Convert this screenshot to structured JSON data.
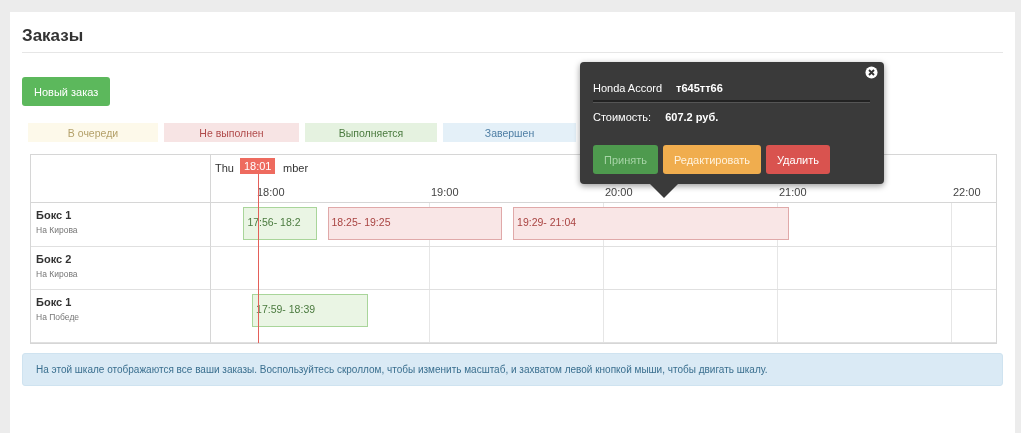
{
  "title": "Заказы",
  "new_order_button": "Новый заказ",
  "legend": [
    {
      "label": "В очереди",
      "kind": "queued"
    },
    {
      "label": "Не выполнен",
      "kind": "failed"
    },
    {
      "label": "Выполняется",
      "kind": "running"
    },
    {
      "label": "Завершен",
      "kind": "done"
    }
  ],
  "timeline": {
    "date_start": "Thu",
    "date_end": "mber",
    "now": "18:01",
    "hours": [
      "18:00",
      "19:00",
      "20:00",
      "21:00",
      "22:00"
    ],
    "rows": [
      {
        "name": "Бокс 1",
        "place": "На Кирова",
        "items": [
          {
            "label": "17:56- 18:2",
            "kind": "running"
          },
          {
            "label": "18:25- 19:25",
            "kind": "failed"
          },
          {
            "label": "19:29- 21:04",
            "kind": "failed"
          }
        ]
      },
      {
        "name": "Бокс 2",
        "place": "На Кирова",
        "items": []
      },
      {
        "name": "Бокс 1",
        "place": "На Победе",
        "items": [
          {
            "label": "17:59- 18:39",
            "kind": "running"
          }
        ]
      }
    ]
  },
  "popup": {
    "car": "Honda Accord",
    "plate": "т645тт66",
    "cost_label": "Стоимость:",
    "cost": "607.2 руб.",
    "buttons": [
      {
        "label": "Принять",
        "kind": "accept"
      },
      {
        "label": "Редактировать",
        "kind": "edit"
      },
      {
        "label": "Удалить",
        "kind": "delete"
      }
    ]
  },
  "info": "На этой шкале отображаются все ваши заказы. Воспользуйтесь скроллом, чтобы изменить масштаб, и захватом левой кнопкой мыши, чтобы двигать шкалу."
}
